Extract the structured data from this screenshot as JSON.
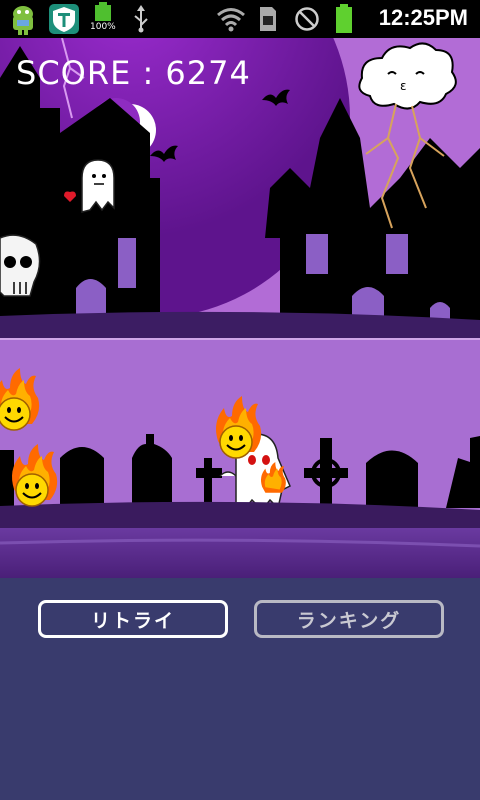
{
  "status_bar": {
    "time": "12:25PM",
    "battery_percent": "100%",
    "icons": [
      "android-icon",
      "t-shield-app-icon",
      "battery-small-icon",
      "usb-icon",
      "wifi-icon",
      "sim-card-icon",
      "no-signal-icon",
      "battery-icon"
    ]
  },
  "game": {
    "score_text": "SCORE : 6274",
    "sprites": [
      "castle-left",
      "castle-right",
      "moon",
      "bats",
      "storm-cloud",
      "ghost-with-heart",
      "skull",
      "fire-smiley",
      "ghost",
      "tombstones",
      "celtic-cross",
      "grave-cross"
    ]
  },
  "buttons": {
    "retry_label": "リトライ",
    "ranking_label": "ランキング"
  },
  "colors": {
    "sky": "#b26cd6",
    "moon_glow": "#8b27b9",
    "silhouette": "#000000",
    "ground": "#5a2f86",
    "bottom_panel": "#393b6d"
  }
}
